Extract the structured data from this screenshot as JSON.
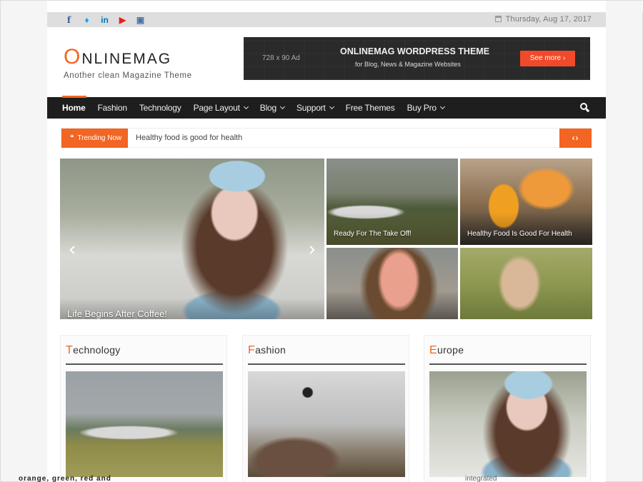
{
  "topbar": {
    "social": [
      {
        "icon": "facebook-icon",
        "glyph": "f"
      },
      {
        "icon": "twitter-icon",
        "glyph": "♦"
      },
      {
        "icon": "linkedin-icon",
        "glyph": "in"
      },
      {
        "icon": "youtube-icon",
        "glyph": "▶"
      },
      {
        "icon": "instagram-icon",
        "glyph": "▣"
      }
    ],
    "date": "Thursday, Aug 17, 2017"
  },
  "header": {
    "logo_first": "O",
    "logo_rest": "NLINEMAG",
    "tagline": "Another clean Magazine Theme"
  },
  "ad": {
    "size_label": "728 x 90 Ad",
    "title": "ONLINEMAG WORDPRESS THEME",
    "subtitle": "for Blog, News & Magazine Websites",
    "button": "See more ›"
  },
  "nav": {
    "items": [
      {
        "label": "Home",
        "active": true,
        "dropdown": false
      },
      {
        "label": "Fashion",
        "dropdown": false
      },
      {
        "label": "Technology",
        "dropdown": false
      },
      {
        "label": "Page Layout",
        "dropdown": true
      },
      {
        "label": "Blog",
        "dropdown": true
      },
      {
        "label": "Support",
        "dropdown": true
      },
      {
        "label": "Free Themes",
        "dropdown": false
      },
      {
        "label": "Buy Pro",
        "dropdown": true
      }
    ]
  },
  "trending": {
    "label": "Trending Now",
    "icon": "❝",
    "text": "Healthy food is good for health",
    "nav": "‹›"
  },
  "slider": {
    "main_caption": "Life Begins After Coffee!",
    "tiles": [
      {
        "caption": "Ready For The Take Off!"
      },
      {
        "caption": "Healthy Food Is Good For Health"
      },
      {
        "caption": ""
      },
      {
        "caption": ""
      }
    ]
  },
  "categories": [
    {
      "first": "T",
      "rest": "echnology"
    },
    {
      "first": "F",
      "rest": "ashion"
    },
    {
      "first": "E",
      "rest": "urope"
    }
  ],
  "overflow": {
    "left": "orange, green, red and",
    "right": "integrated"
  },
  "colors": {
    "accent": "#f26522",
    "nav_bg": "#1e1e1e",
    "ad_button": "#f04a2a"
  }
}
